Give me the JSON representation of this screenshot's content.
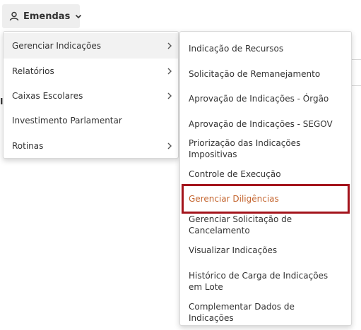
{
  "top_button": {
    "label": "Emendas",
    "icon": "user-icon",
    "chevron": "chevron-down-icon"
  },
  "background": {
    "stray_char": "I"
  },
  "main_menu": {
    "items": [
      {
        "label": "Gerenciar Indicações",
        "has_submenu": true,
        "active": true
      },
      {
        "label": "Relatórios",
        "has_submenu": true
      },
      {
        "label": "Caixas Escolares",
        "has_submenu": true
      },
      {
        "label": "Investimento Parlamentar",
        "has_submenu": false
      },
      {
        "label": "Rotinas",
        "has_submenu": true
      }
    ]
  },
  "submenu": {
    "items": [
      {
        "label": "Indicação de Recursos"
      },
      {
        "label": "Solicitação de Remanejamento"
      },
      {
        "label": "Aprovação de Indicações - Órgão"
      },
      {
        "label": "Aprovação de Indicações - SEGOV"
      },
      {
        "label": "Priorização das Indicações Impositivas"
      },
      {
        "label": "Controle de Execução"
      },
      {
        "label": "Gerenciar Diligências",
        "highlighted": true
      },
      {
        "label": "Gerenciar Solicitação de Cancelamento"
      },
      {
        "label": "Visualizar Indicações"
      },
      {
        "label": "Histórico de Carga de Indicações em Lote"
      },
      {
        "label": "Complementar Dados de Indicações"
      }
    ]
  },
  "colors": {
    "highlight_text": "#c4652f",
    "highlight_border": "#a3131b",
    "active_bg": "#f2f2f2"
  }
}
